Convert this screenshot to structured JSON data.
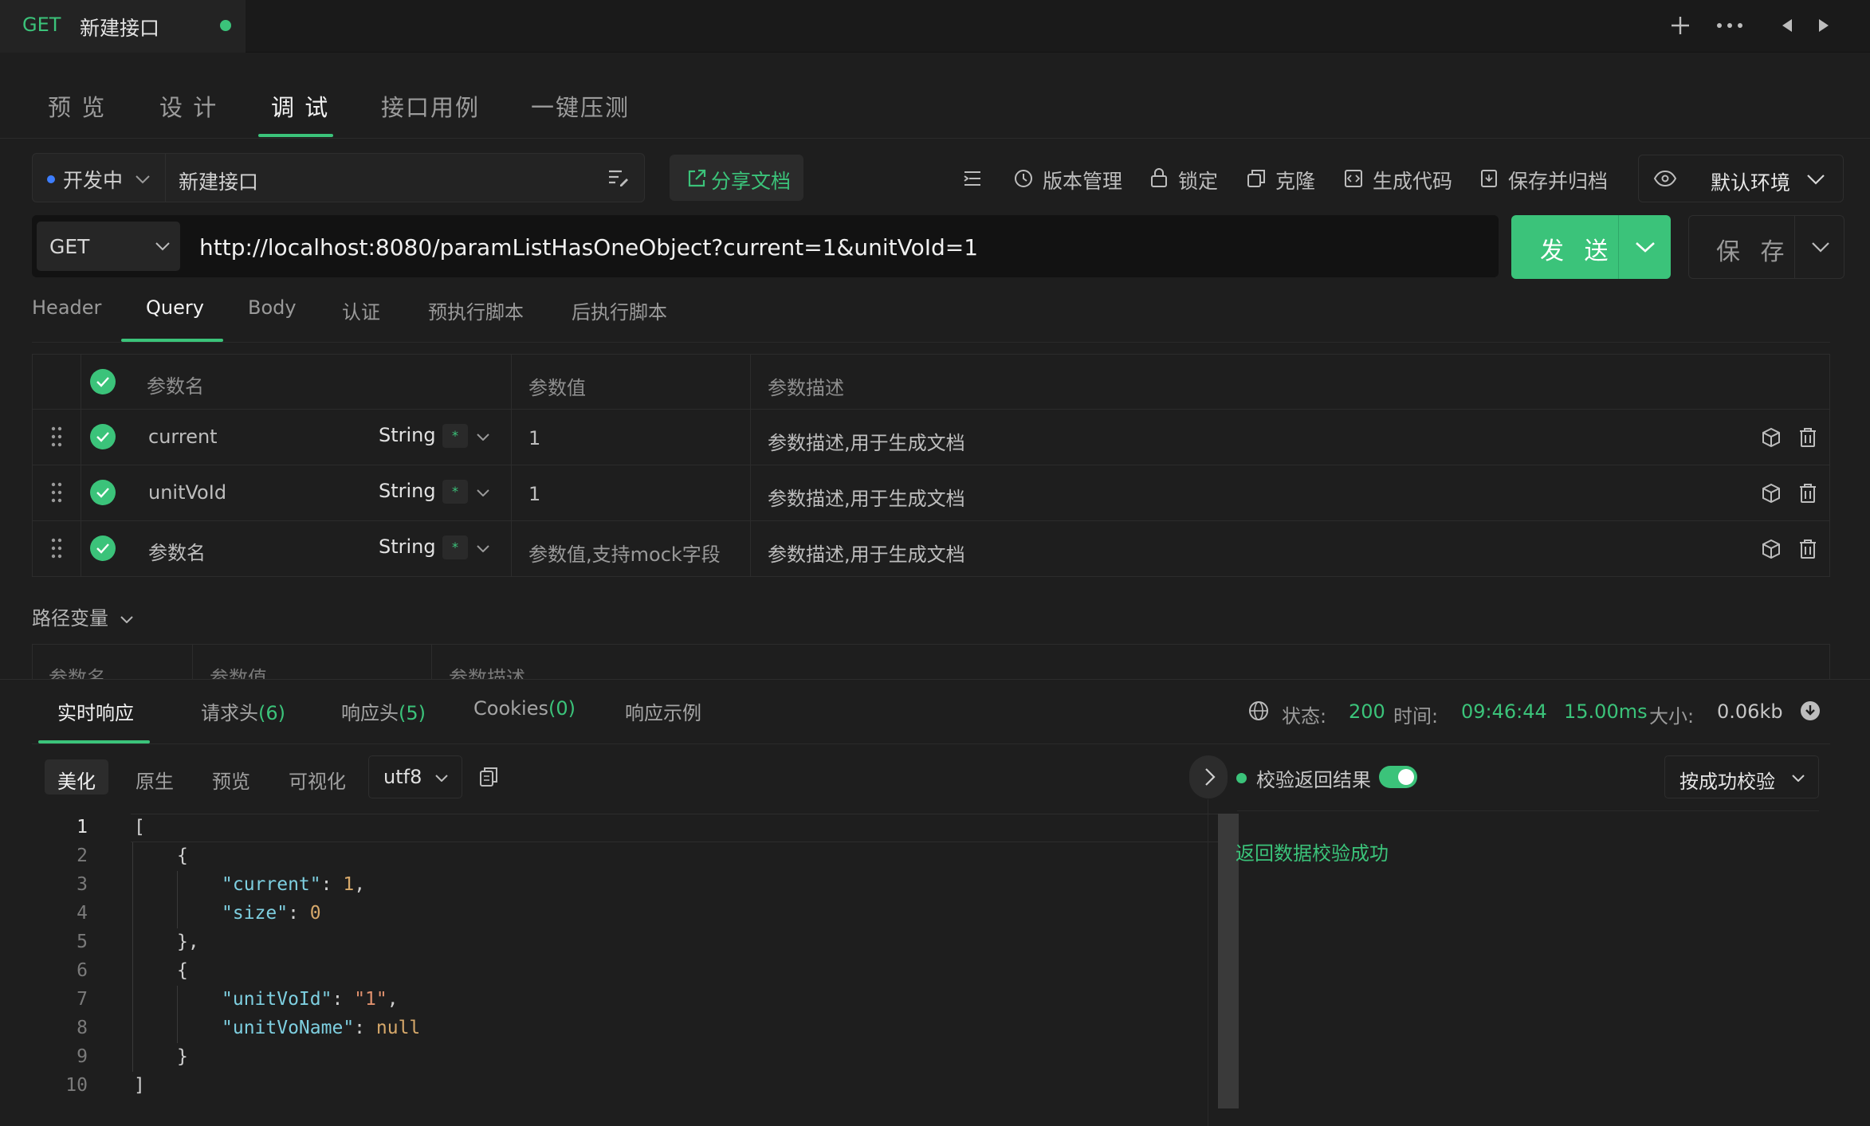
{
  "tab": {
    "method": "GET",
    "name": "新建接口"
  },
  "modes": [
    "预 览",
    "设 计",
    "调 试",
    "接口用例",
    "一键压测"
  ],
  "status": {
    "label": "开发中",
    "name": "新建接口"
  },
  "share_label": "分享文档",
  "toolbar": {
    "version": "版本管理",
    "lock": "锁定",
    "clone": "克隆",
    "gencode": "生成代码",
    "archive": "保存并归档"
  },
  "env": "默认环境",
  "request": {
    "method": "GET",
    "url": "http://localhost:8080/paramListHasOneObject?current=1&unitVoId=1"
  },
  "send_label": "发 送",
  "save_label": "保 存",
  "subtabs": [
    "Header",
    "Query",
    "Body",
    "认证",
    "预执行脚本",
    "后执行脚本"
  ],
  "params": {
    "headers": {
      "name": "参数名",
      "value": "参数值",
      "desc": "参数描述"
    },
    "rows": [
      {
        "name": "current",
        "type": "String",
        "required": "*",
        "value": "1",
        "desc": "参数描述,用于生成文档"
      },
      {
        "name": "unitVoId",
        "type": "String",
        "required": "*",
        "value": "1",
        "desc": "参数描述,用于生成文档"
      },
      {
        "name": "参数名",
        "type": "String",
        "required": "*",
        "value": "参数值,支持mock字段",
        "desc": "参数描述,用于生成文档"
      }
    ]
  },
  "path_vars": {
    "title": "路径变量",
    "headers": {
      "name": "参数名",
      "value": "参数值",
      "desc": "参数描述"
    }
  },
  "response": {
    "tabs": {
      "live": "实时响应",
      "req_headers": "请求头",
      "req_headers_count": "(6)",
      "resp_headers": "响应头",
      "resp_headers_count": "(5)",
      "cookies": "Cookies",
      "cookies_count": "(0)",
      "example": "响应示例"
    },
    "status_label": "状态:",
    "status": "200",
    "time_label": "时间:",
    "time": "09:46:44",
    "duration": "15.00ms",
    "size_label": "大小:",
    "size": "0.06kb",
    "formats": [
      "美化",
      "原生",
      "预览",
      "可视化"
    ],
    "encoding": "utf8",
    "line_numbers": [
      "1",
      "2",
      "3",
      "4",
      "5",
      "6",
      "7",
      "8",
      "9",
      "10"
    ],
    "validate_label": "校验返回结果",
    "validate_mode": "按成功校验",
    "validate_result": "返回数据校验成功"
  },
  "colors": {
    "accent": "#3bc37a",
    "background": "#1e1e1e",
    "status_dot": "#3d7eff"
  }
}
